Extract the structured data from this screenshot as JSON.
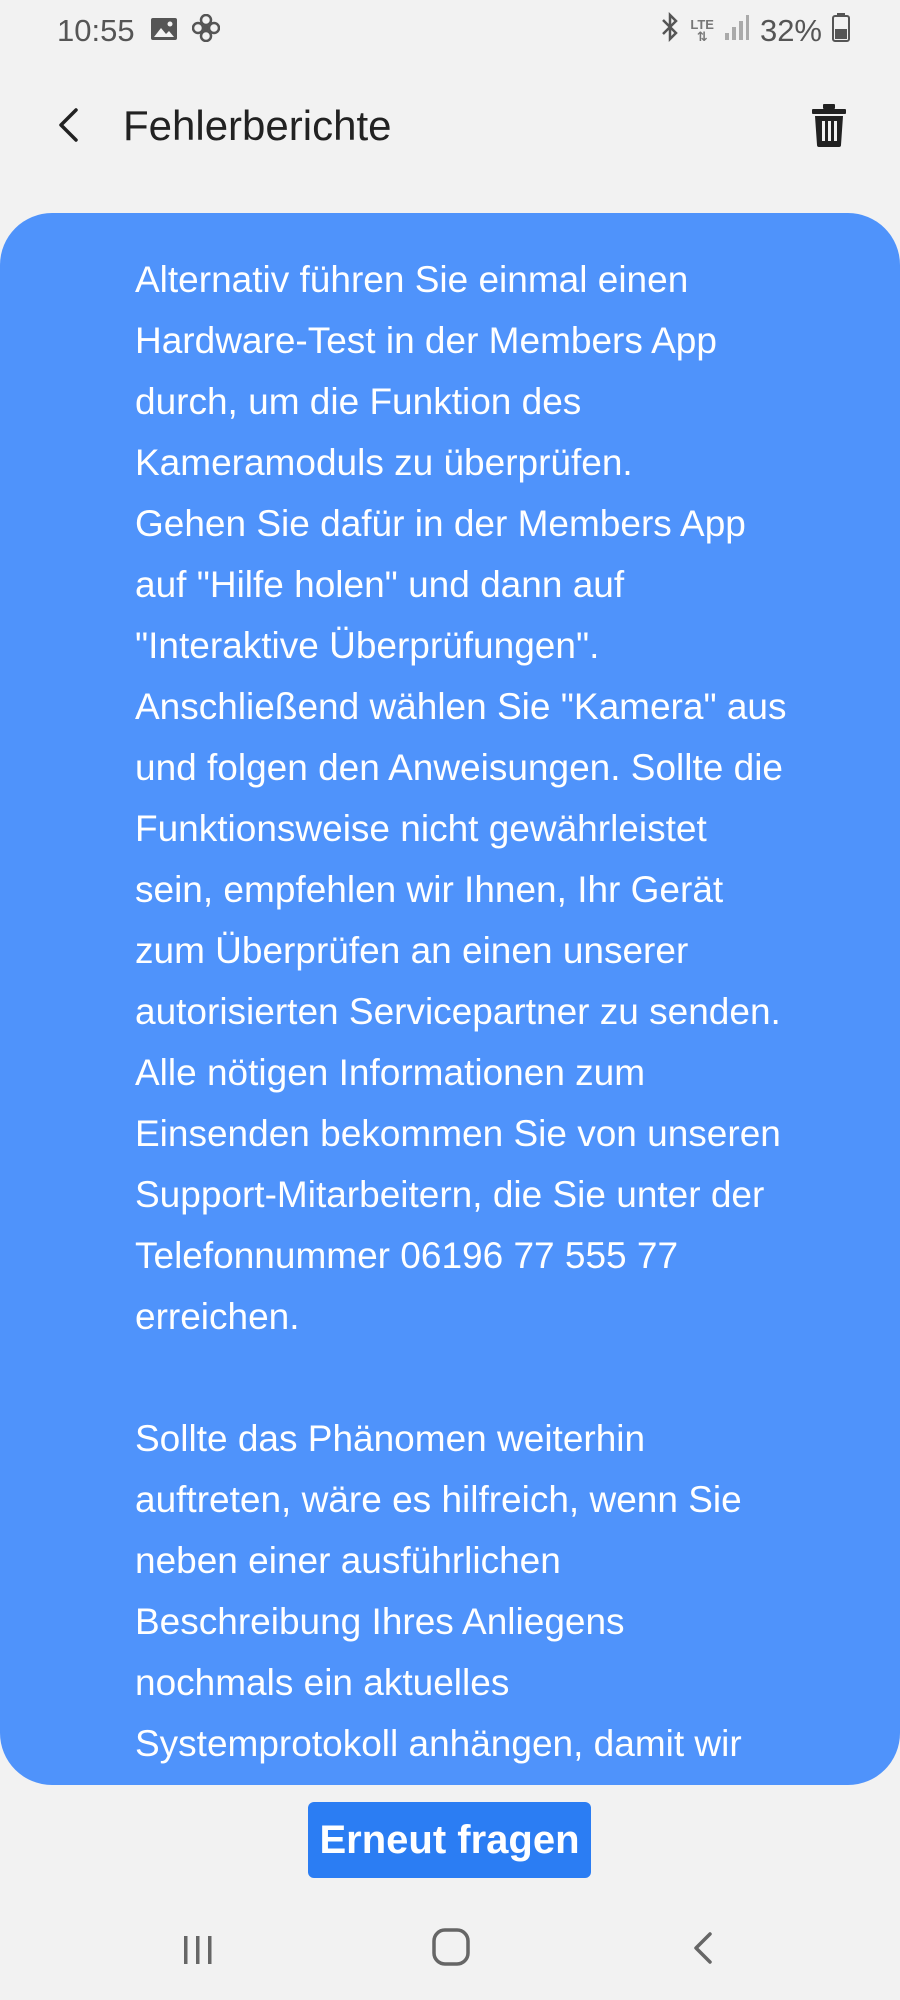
{
  "status_bar": {
    "time": "10:55",
    "network": "LTE",
    "battery_percent": "32%",
    "icons": [
      "image-icon",
      "fan-icon",
      "bluetooth-icon",
      "lte-icon",
      "signal-icon",
      "battery-icon"
    ]
  },
  "header": {
    "title": "Fehlerberichte",
    "back_icon": "back-arrow-icon",
    "delete_icon": "trash-icon"
  },
  "message": {
    "text": "Alternativ führen Sie einmal einen\nHardware-Test in der Members App\ndurch, um die Funktion des\nKameramoduls zu überprüfen.\nGehen Sie dafür in der Members App\nauf \"Hilfe holen\" und dann auf\n\"Interaktive Überprüfungen\".\nAnschließend wählen Sie \"Kamera\" aus\nund folgen den Anweisungen. Sollte die\nFunktionsweise nicht gewährleistet\nsein, empfehlen wir Ihnen, Ihr Gerät\nzum Überprüfen an einen unserer\nautorisierten Servicepartner zu senden.\nAlle nötigen Informationen zum\nEinsenden bekommen Sie von unseren\nSupport-Mitarbeitern, die Sie unter der\nTelefonnummer 06196 77 555 77\nerreichen.\n\nSollte das Phänomen weiterhin\nauftreten, wäre es hilfreich, wenn Sie\nneben einer ausführlichen\nBeschreibung Ihres Anliegens\nnochmals ein aktuelles\nSystemprotokoll anhängen, damit wir\nIhren Fall intensiver prüfen können.",
    "bubble_color": "#4f93fb"
  },
  "actions": {
    "ask_again_label": "Erneut fragen",
    "button_color": "#2b7df3"
  },
  "nav_bar": {
    "icons": [
      "recents-icon",
      "home-icon",
      "back-icon"
    ]
  }
}
